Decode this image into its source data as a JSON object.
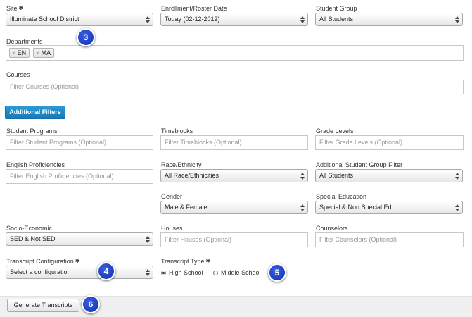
{
  "site": {
    "label": "Site",
    "required_mark": "✱",
    "value": "Illuminate School District"
  },
  "enrollment": {
    "label": "Enrollment/Roster Date",
    "value": "Today (02-12-2012)"
  },
  "student_group": {
    "label": "Student Group",
    "value": "All Students"
  },
  "departments": {
    "label": "Departments",
    "tags": [
      "EN",
      "MA"
    ],
    "remove_glyph": "×"
  },
  "courses": {
    "label": "Courses",
    "placeholder": "Filter Courses (Optional)"
  },
  "additional_filters_label": "Additional Filters",
  "student_programs": {
    "label": "Student Programs",
    "placeholder": "Filter Student Programs (Optional)"
  },
  "timeblocks": {
    "label": "Timeblocks",
    "placeholder": "Filter Timeblocks (Optional)"
  },
  "grade_levels": {
    "label": "Grade Levels",
    "placeholder": "Filter Grade Levels (Optional)"
  },
  "english_proficiencies": {
    "label": "English Proficiencies",
    "placeholder": "Filter English Proficiencies (Optional)"
  },
  "race": {
    "label": "Race/Ethnicity",
    "value": "All Race/Ethnicities"
  },
  "additional_group": {
    "label": "Additional Student Group Filter",
    "value": "All Students"
  },
  "gender": {
    "label": "Gender",
    "value": "Male & Female"
  },
  "special_education": {
    "label": "Special Education",
    "value": "Special & Non Special Ed"
  },
  "socio_economic": {
    "label": "Socio-Economic",
    "value": "SED & Not SED"
  },
  "houses": {
    "label": "Houses",
    "placeholder": "Filter Houses (Optional)"
  },
  "counselors": {
    "label": "Counselors",
    "placeholder": "Filter Counselors (Optional)"
  },
  "transcript_config": {
    "label": "Transcript Configuration",
    "required_mark": "✱",
    "value": "Select a configuration"
  },
  "transcript_type": {
    "label": "Transcript Type",
    "required_mark": "✱",
    "options": [
      "High School",
      "Middle School"
    ],
    "selected": "High School"
  },
  "generate_label": "Generate Transcripts",
  "callouts": [
    "3",
    "4",
    "5",
    "6"
  ],
  "colors": {
    "accent": "#1a84c7",
    "callout": "#1f3fd0",
    "footer_bg": "#f0f0f0"
  }
}
